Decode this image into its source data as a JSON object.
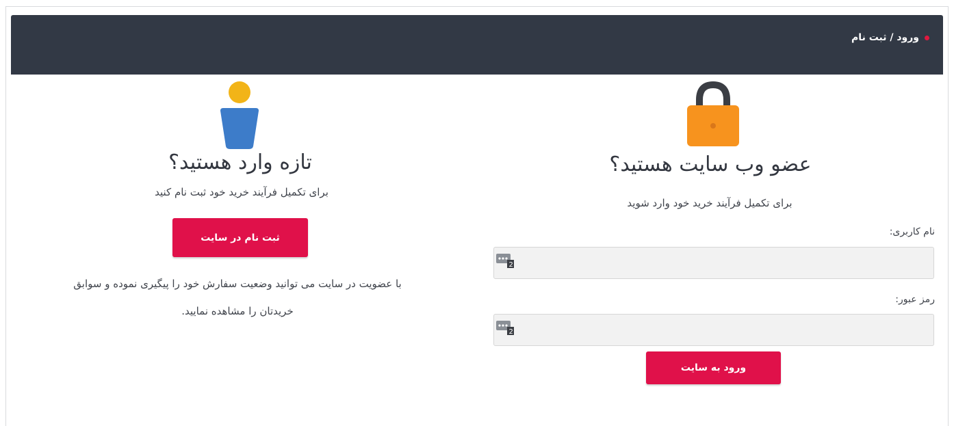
{
  "header": {
    "title": "ورود / ثبت نام",
    "bar_color": "#323945",
    "dot_color": "#e0193f"
  },
  "register": {
    "icon": "person-icon",
    "heading": "تازه وارد هستید؟",
    "subtext": "برای تکمیل فرآیند خرید خود ثبت نام کنید",
    "button_label": "ثبت نام در سایت",
    "info_line1": "با عضویت در سایت می توانید وضعیت سفارش خود را پیگیری نموده و سوابق",
    "info_line2": "خریدتان را مشاهده نمایید."
  },
  "login": {
    "icon": "lock-icon",
    "heading": "عضو وب سایت هستید؟",
    "subtext": "برای تکمیل فرآیند خرید خود وارد شوید",
    "username_label": "نام کاربری:",
    "username_value": "",
    "password_label": "رمز عبور:",
    "password_value": "",
    "password_manager_icon": "password-manager-icon",
    "button_label": "ورود به سایت"
  },
  "colors": {
    "accent": "#e0114a",
    "person_head": "#f2b418",
    "person_body": "#3d7cc9",
    "lock_body": "#f7931e",
    "lock_shackle": "#3b3e44"
  }
}
